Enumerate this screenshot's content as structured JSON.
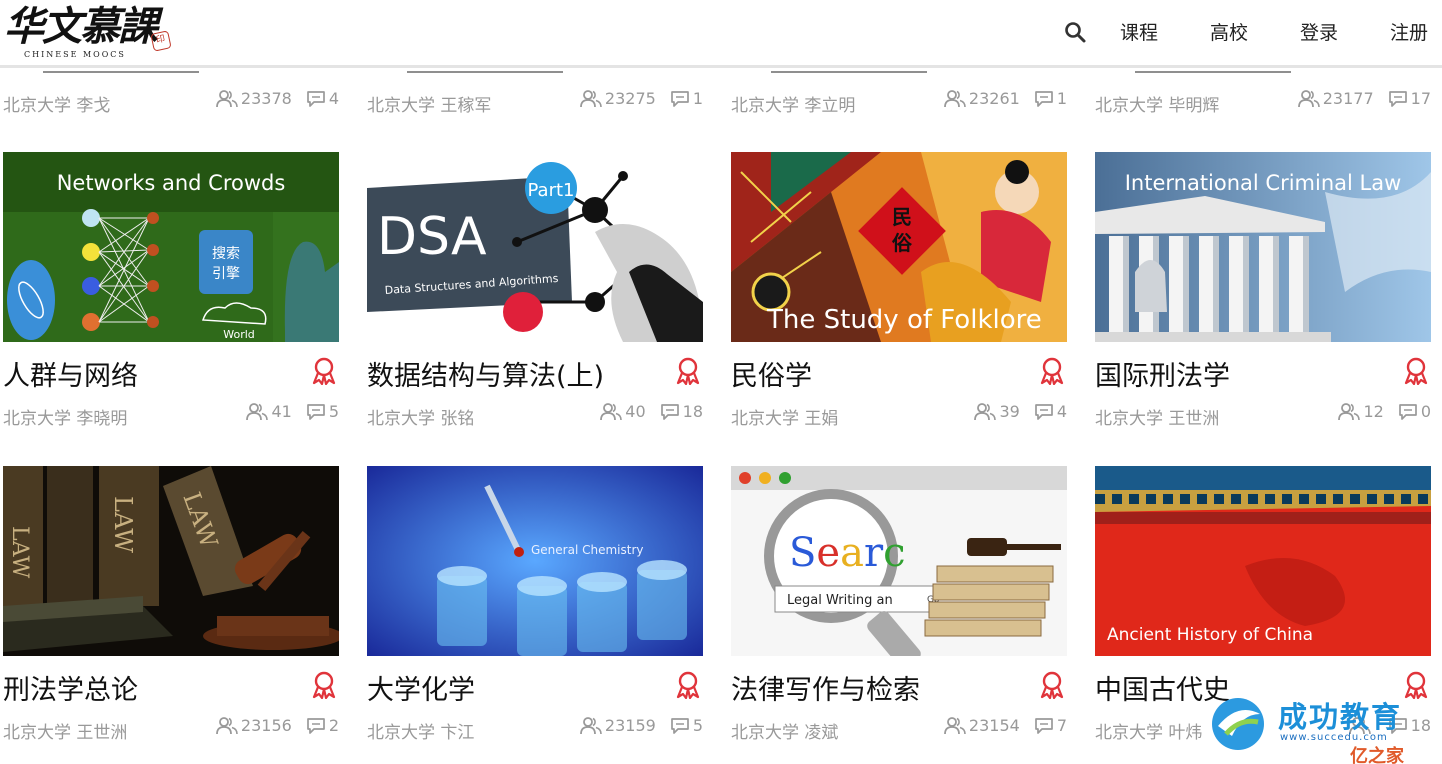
{
  "logo": {
    "cn": "华文慕課",
    "en": "CHINESE MOOCS"
  },
  "nav": {
    "courses": "课程",
    "schools": "高校",
    "login": "登录",
    "register": "注册"
  },
  "prev_row": [
    {
      "teacher": "北京大学 李戈",
      "students": "23378",
      "comments": "4"
    },
    {
      "teacher": "北京大学 王稼军",
      "students": "23275",
      "comments": "1"
    },
    {
      "teacher": "北京大学 李立明",
      "students": "23261",
      "comments": "1"
    },
    {
      "teacher": "北京大学 毕明辉",
      "students": "23177",
      "comments": "17"
    }
  ],
  "courses": [
    {
      "title": "人群与网络",
      "teacher": "北京大学 李晓明",
      "students": "41",
      "comments": "5",
      "thumb_text": "Networks and Crowds",
      "thumb_label1": "搜索",
      "thumb_label2": "引擎",
      "thumb_label3": "World"
    },
    {
      "title": "数据结构与算法(上)",
      "teacher": "北京大学 张铭",
      "students": "40",
      "comments": "18",
      "thumb_text": "DSA",
      "thumb_sub": "Data Structures and Algorithms",
      "thumb_badge": "Part1"
    },
    {
      "title": "民俗学",
      "teacher": "北京大学 王娟",
      "students": "39",
      "comments": "4",
      "thumb_text": "The Study of Folklore",
      "thumb_label1": "民",
      "thumb_label2": "俗"
    },
    {
      "title": "国际刑法学",
      "teacher": "北京大学 王世洲",
      "students": "12",
      "comments": "0",
      "thumb_text": "International Criminal Law"
    },
    {
      "title": "刑法学总论",
      "teacher": "北京大学 王世洲",
      "students": "23156",
      "comments": "2",
      "thumb_text": "LAW"
    },
    {
      "title": "大学化学",
      "teacher": "北京大学 卞江",
      "students": "23159",
      "comments": "5",
      "thumb_text": "General Chemistry"
    },
    {
      "title": "法律写作与检索",
      "teacher": "北京大学 凌斌",
      "students": "23154",
      "comments": "7",
      "thumb_text": "Searc",
      "thumb_sub": "Legal Writing an",
      "thumb_badge": "Go"
    },
    {
      "title": "中国古代史",
      "teacher": "北京大学 叶炜",
      "students": "",
      "comments": "18",
      "thumb_text": "Ancient History of China"
    }
  ],
  "watermark": {
    "title": "成功教育",
    "url": "www.succedu.com",
    "sub": "亿之家"
  },
  "colors": {
    "accent_red": "#e0343b",
    "meta_gray": "#999999",
    "watermark_blue": "#1c8fd8"
  }
}
